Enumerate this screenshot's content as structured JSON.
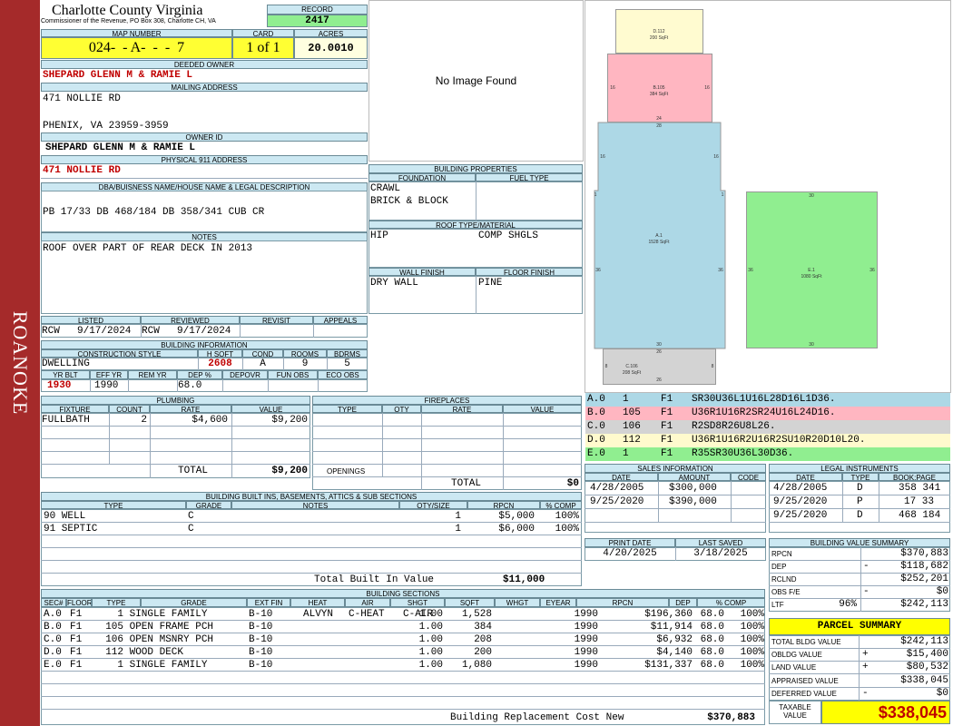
{
  "side_label": "ROANOKE",
  "county": {
    "name": "Charlotte County Virginia",
    "address": "Commissioner of the Revenue, PO Box 308, Charlotte CH, VA"
  },
  "record": {
    "label": "RECORD",
    "value": "2417"
  },
  "map": {
    "label": "MAP NUMBER",
    "value": "024-  - A-  -  -  7"
  },
  "card": {
    "label": "CARD",
    "value": "1 of 1"
  },
  "acres": {
    "label": "ACRES",
    "value": "20.0010"
  },
  "deeded_owner": {
    "label": "DEEDED OWNER",
    "value": "SHEPARD GLENN M & RAMIE L"
  },
  "mailing": {
    "label": "MAILING ADDRESS",
    "line1": "471 NOLLIE RD",
    "line2": "PHENIX, VA 23959-3959"
  },
  "owner_id": {
    "label": "OWNER ID",
    "value": "SHEPARD GLENN M & RAMIE L"
  },
  "physical": {
    "label": "PHYSICAL 911 ADDRESS",
    "value": "471 NOLLIE RD"
  },
  "legal_desc": {
    "label": "DBA/BUISNESS NAME/HOUSE NAME & LEGAL DESCRIPTION",
    "value": "PB 17/33 DB 468/184 DB 358/341 CUB CR"
  },
  "notes": {
    "label": "NOTES",
    "value": "ROOF OVER PART OF REAR DECK IN 2013"
  },
  "photo": {
    "placeholder": "No Image Found"
  },
  "building_props": {
    "label": "BUILDING PROPERTIES",
    "foundation_label": "FOUNDATION",
    "fuel_label": "FUEL TYPE",
    "foundation1": "CRAWL",
    "foundation2": "BRICK & BLOCK",
    "fuel": "",
    "roof_label": "ROOF TYPE/MATERIAL",
    "roof_type": "HIP",
    "roof_material": "COMP SHGLS",
    "wall_label": "WALL FINISH",
    "floor_label": "FLOOR FINISH",
    "wall": "DRY WALL",
    "floor": "PINE"
  },
  "listing": {
    "listed_label": "LISTED",
    "reviewed_label": "REVIEWED",
    "revisit_label": "REVISIT",
    "appeals_label": "APPEALS",
    "listed_by": "RCW",
    "listed_date": "9/17/2024",
    "reviewed_by": "RCW",
    "reviewed_date": "9/17/2024",
    "revisit": "",
    "appeals": ""
  },
  "building_info": {
    "label": "BUILDING INFORMATION",
    "construction_label": "CONSTRUCTION STYLE",
    "hsqft_label": "H SQFT",
    "cond_label": "COND",
    "rooms_label": "ROOMS",
    "bdrms_label": "BDRMS",
    "construction": "DWELLING",
    "hsqft": "2608",
    "cond": "A",
    "rooms": "9",
    "bdrms": "5",
    "yrblt_label": "YR BLT",
    "effyr_label": "EFF YR",
    "remyr_label": "REM YR",
    "dep_label": "DEP %",
    "depovr_label": "DEPOVR",
    "funobs_label": "FUN OBS",
    "ecoobs_label": "ECO OBS",
    "yrblt": "1930",
    "effyr": "1990",
    "remyr": "",
    "dep": "68.0",
    "depovr": "",
    "funobs": "",
    "ecoobs": ""
  },
  "plumbing": {
    "label": "PLUMBING",
    "cols": [
      "FIXTURE",
      "COUNT",
      "RATE",
      "VALUE"
    ],
    "rows": [
      [
        "FULLBATH",
        "2",
        "$4,600",
        "$9,200"
      ]
    ],
    "total_label": "TOTAL",
    "total": "$9,200"
  },
  "fireplaces": {
    "label": "FIREPLACES",
    "cols": [
      "TYPE",
      "QTY",
      "RATE",
      "VALUE"
    ],
    "openings_label": "OPENINGS",
    "total_label": "TOTAL",
    "total": "$0"
  },
  "built_ins": {
    "label": "BUILDING BUILT INS, BASEMENTS, ATTICS & SUB SECTIONS",
    "cols": [
      "TYPE",
      "GRADE",
      "NOTES",
      "QTY/SIZE",
      "RPCN",
      "% COMP"
    ],
    "rows": [
      [
        "90 WELL",
        "C",
        "",
        "1",
        "$5,000",
        "100%"
      ],
      [
        "91 SEPTIC",
        "C",
        "",
        "1",
        "$6,000",
        "100%"
      ]
    ],
    "total_label": "Total Built In Value",
    "total": "$11,000"
  },
  "sections_legend": [
    {
      "sec": "A.0",
      "num": "1",
      "floor": "F1",
      "code": "SR30U36L1U16L28D16L1D36.",
      "bg": "#add8e6"
    },
    {
      "sec": "B.0",
      "num": "105",
      "floor": "F1",
      "code": "U36R1U16R2SR24U16L24D16.",
      "bg": "#ffb6c1"
    },
    {
      "sec": "C.0",
      "num": "106",
      "floor": "F1",
      "code": "R2SD8R26U8L26.",
      "bg": "#d3d3d3"
    },
    {
      "sec": "D.0",
      "num": "112",
      "floor": "F1",
      "code": "U36R1U16R2U16R2SU10R20D10L20.",
      "bg": "#fffacd"
    },
    {
      "sec": "E.0",
      "num": "1",
      "floor": "F1",
      "code": "R35SR30U36L30D36.",
      "bg": "#90ee90"
    }
  ],
  "sketch": {
    "d": {
      "label": "D.112",
      "area": "200 SqFt",
      "side": "24"
    },
    "b": {
      "label": "B.105",
      "area": "384 SqFt",
      "top": "24",
      "bottom": "24",
      "left": "16",
      "right": "16"
    },
    "a": {
      "label": "A.1",
      "area": "1528 SqFt",
      "top": "28",
      "bottom": "30",
      "left": "36",
      "right": "36",
      "left_top": "16",
      "right_top": "16",
      "notch_l": "1",
      "notch_r": "1"
    },
    "c": {
      "label": "C.106",
      "area": "208 SqFt",
      "top": "26",
      "bottom": "26",
      "left": "8",
      "right": "8"
    },
    "e": {
      "label": "E.1",
      "area": "1080 SqFt",
      "top": "30",
      "bottom": "30",
      "left": "36",
      "right": "36"
    }
  },
  "sales": {
    "label": "SALES INFORMATION",
    "cols": [
      "DATE",
      "AMOUNT",
      "CODE"
    ],
    "rows": [
      [
        "4/28/2005",
        "$300,000",
        ""
      ],
      [
        "9/25/2020",
        "$390,000",
        ""
      ]
    ]
  },
  "legal": {
    "label": "LEGAL INSTRUMENTS",
    "cols": [
      "DATE",
      "TYPE",
      "BOOK:PAGE"
    ],
    "rows": [
      [
        "4/28/2005",
        "D",
        "358 341"
      ],
      [
        "9/25/2020",
        "P",
        "17 33"
      ],
      [
        "9/25/2020",
        "D",
        "468 184"
      ]
    ]
  },
  "print_date": {
    "label": "PRINT DATE",
    "value": "4/20/2025"
  },
  "last_saved": {
    "label": "LAST SAVED",
    "value": "3/18/2025"
  },
  "bvs": {
    "label": "BUILDING VALUE SUMMARY",
    "rows": [
      [
        "RPCN",
        "",
        "$370,883"
      ],
      [
        "DEP",
        "-",
        "$118,682"
      ],
      [
        "RCLND",
        "",
        "$252,201"
      ],
      [
        "OBS F/E",
        "-",
        "$0"
      ],
      [
        "LTF",
        "96%",
        "$242,113"
      ]
    ]
  },
  "parcel": {
    "label": "PARCEL SUMMARY",
    "rows": [
      [
        "TOTAL BLDG VALUE",
        "",
        "$242,113"
      ],
      [
        "OBLDG VALUE",
        "+",
        "$15,400"
      ],
      [
        "LAND VALUE",
        "+",
        "$80,532"
      ],
      [
        "APPRAISED VALUE",
        "",
        "$338,045"
      ],
      [
        "DEFERRED VALUE",
        "-",
        "$0"
      ]
    ],
    "taxable_label": "TAXABLE VALUE",
    "taxable": "$338,045"
  },
  "sections": {
    "label": "BUILDING SECTIONS",
    "cols": [
      "SEC#",
      "FLOOR",
      "TYPE",
      "GRADE",
      "EXT FIN",
      "HEAT",
      "AIR",
      "SHGT",
      "SQFT",
      "WHGT",
      "EYEAR",
      "RPCN",
      "DEP",
      "% COMP"
    ],
    "rows": [
      [
        "A.0",
        "F1",
        "1 SINGLE FAMILY",
        "B-10",
        "ALVYN",
        "C-HEAT",
        "C-AIR",
        "1.00",
        "1,528",
        "",
        "1990",
        "$196,360",
        "68.0",
        "100%"
      ],
      [
        "B.0",
        "F1",
        "105 OPEN FRAME PCH",
        "B-10",
        "",
        "",
        "",
        "1.00",
        "384",
        "",
        "1990",
        "$11,914",
        "68.0",
        "100%"
      ],
      [
        "C.0",
        "F1",
        "106 OPEN MSNRY PCH",
        "B-10",
        "",
        "",
        "",
        "1.00",
        "208",
        "",
        "1990",
        "$6,932",
        "68.0",
        "100%"
      ],
      [
        "D.0",
        "F1",
        "112 WOOD DECK",
        "B-10",
        "",
        "",
        "",
        "1.00",
        "200",
        "",
        "1990",
        "$4,140",
        "68.0",
        "100%"
      ],
      [
        "E.0",
        "F1",
        "1 SINGLE FAMILY",
        "B-10",
        "",
        "",
        "",
        "1.00",
        "1,080",
        "",
        "1990",
        "$131,337",
        "68.0",
        "100%"
      ]
    ],
    "brcn_label": "Building Replacement Cost New",
    "brcn": "$370,883"
  }
}
